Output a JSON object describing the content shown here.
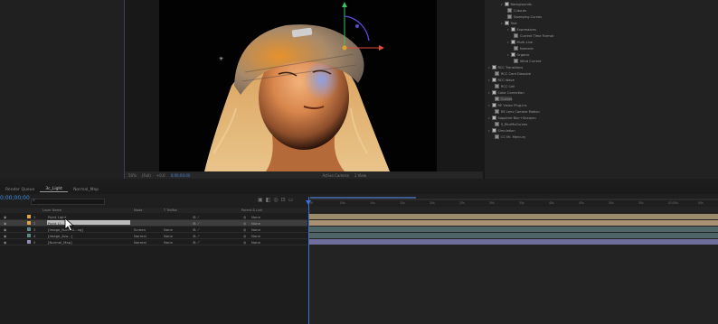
{
  "viewer": {
    "toolbar": [
      "50%",
      "(Full)",
      "+0.0",
      "Active Camera",
      "1 View"
    ],
    "timecode": "0;00;00;00"
  },
  "effects": {
    "items": [
      {
        "label": "Backgrounds",
        "indent": 2,
        "folder": true
      },
      {
        "label": "Cutouts",
        "indent": 3,
        "folder": false
      },
      {
        "label": "Sweeping Curves",
        "indent": 3,
        "folder": false
      },
      {
        "label": "Text",
        "indent": 2,
        "folder": true
      },
      {
        "label": "Expressions",
        "indent": 3,
        "folder": true
      },
      {
        "label": "Current Time Format",
        "indent": 4,
        "folder": false
      },
      {
        "label": "Multi-Line",
        "indent": 3,
        "folder": true
      },
      {
        "label": "Numeric",
        "indent": 4,
        "folder": false
      },
      {
        "label": "Organic",
        "indent": 3,
        "folder": true
      },
      {
        "label": "Wind Current",
        "indent": 4,
        "folder": false
      },
      {
        "label": "RCC Transitions",
        "indent": 0,
        "folder": true
      },
      {
        "label": "RCC Card Dissolve",
        "indent": 1,
        "folder": false
      },
      {
        "label": "RCC Wave",
        "indent": 0,
        "folder": true
      },
      {
        "label": "RCC Cell",
        "indent": 1,
        "folder": false
      },
      {
        "label": "Color Correction",
        "indent": 0,
        "folder": true
      },
      {
        "label": "Curves",
        "indent": 1,
        "folder": false,
        "selected": true
      },
      {
        "label": "RE Vision Plug-ins",
        "indent": 0,
        "folder": true
      },
      {
        "label": "RE Lens Camera Motion",
        "indent": 1,
        "folder": false
      },
      {
        "label": "Sapphire Blur+Sharpen",
        "indent": 0,
        "folder": true
      },
      {
        "label": "S_BlurMoCurves",
        "indent": 1,
        "folder": false
      },
      {
        "label": "Simulation",
        "indent": 0,
        "folder": true
      },
      {
        "label": "CC Mr. Mercury",
        "indent": 1,
        "folder": false
      }
    ]
  },
  "timeline": {
    "tabs": [
      "Render Queue",
      "3c_Light",
      "Normal_Map"
    ],
    "timecode": "0;00;00;00",
    "columns": {
      "layer_name": "Layer Name",
      "mode": "Mode",
      "trkmat": "T TrkMat",
      "parent": "Parent & Link"
    },
    "ruler_ticks": [
      "0f",
      "05s",
      "10s",
      "15s",
      "20s",
      "25s",
      "30s",
      "35s",
      "40s",
      "45s",
      "50s",
      "55s",
      "01:00s",
      "05s"
    ],
    "layers": [
      {
        "index": "1",
        "name": "Point Light",
        "mode": "",
        "trkmat": "",
        "parent": "None",
        "color": "#e2a34b",
        "bar": "#9c8b6b"
      },
      {
        "index": "2",
        "name": "Point Li...",
        "mode": "",
        "trkmat": "",
        "parent": "None",
        "color": "#e2a34b",
        "bar": "#a99273",
        "selected": true
      },
      {
        "index": "3",
        "name": "[Image_Normal...ng]",
        "mode": "Screen",
        "trkmat": "None",
        "parent": "None",
        "color": "#5e8c8c",
        "bar": "#506565"
      },
      {
        "index": "4",
        "name": "[Image_Ava...]",
        "mode": "Normal",
        "trkmat": "None",
        "parent": "None",
        "color": "#5e8c8c",
        "bar": "#4e6466"
      },
      {
        "index": "5",
        "name": "[Normal_Map]",
        "mode": "Normal",
        "trkmat": "None",
        "parent": "None",
        "color": "#8f8fb8",
        "bar": "#6e6e9a"
      }
    ]
  },
  "colors": {
    "timecode_blue": "#3e8ee0",
    "playhead": "#3a73d3"
  }
}
